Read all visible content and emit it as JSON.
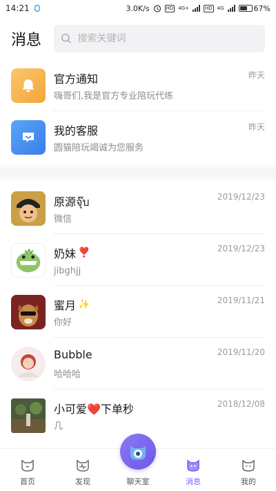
{
  "status_bar": {
    "time": "14:21",
    "speed": "3.0K/s",
    "hd1": "HD",
    "net1": "4G+",
    "hd2": "HD",
    "net2": "4G",
    "battery": "67%",
    "battery_level": 0.67
  },
  "header": {
    "title": "消息",
    "search_placeholder": "搜索关键词"
  },
  "system_items": [
    {
      "name": "官方通知",
      "preview": "嗨哥们,我是官方专业陪玩代练",
      "time": "昨天",
      "icon": "bell-icon"
    },
    {
      "name": "我的客服",
      "preview": "圆猫陪玩竭诚为您服务",
      "time": "昨天",
      "icon": "chat-icon"
    }
  ],
  "conversations": [
    {
      "name": "原源จุ๊บ",
      "emoji": "",
      "preview": "微信",
      "time": "2019/12/23"
    },
    {
      "name": "奶妹",
      "emoji": "❣️",
      "preview": "jibghjj",
      "time": "2019/12/23"
    },
    {
      "name": "蜜月",
      "emoji": "✨",
      "preview": "你好",
      "time": "2019/11/21"
    },
    {
      "name": "Bubble",
      "emoji": "",
      "preview": "哈哈哈",
      "time": "2019/11/20"
    },
    {
      "name": "小可爱❤️下单秒",
      "emoji": "",
      "preview": "几",
      "time": "2018/12/08"
    }
  ],
  "nav": {
    "home": "首页",
    "discover": "发现",
    "chatroom": "聊天室",
    "messages": "消息",
    "mine": "我的"
  },
  "colors": {
    "accent": "#7d5cf0",
    "official": "#f4a53b",
    "service": "#3b7de9"
  }
}
